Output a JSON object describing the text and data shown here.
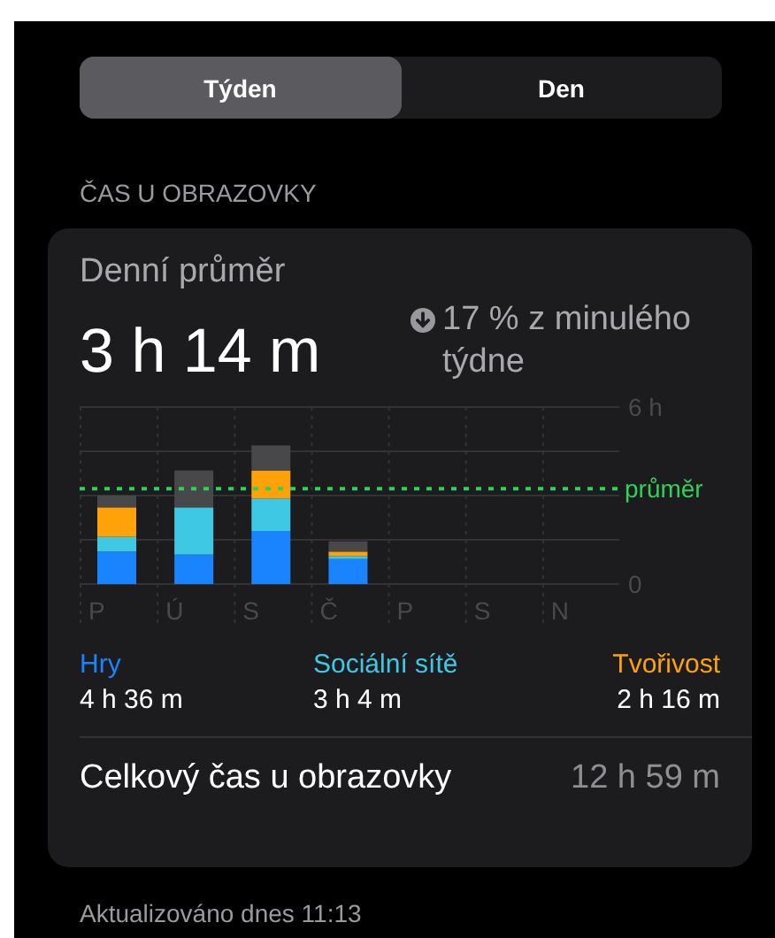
{
  "tabs": [
    {
      "label": "Týden",
      "selected": true
    },
    {
      "label": "Den",
      "selected": false
    }
  ],
  "section_title": "ČAS U OBRAZOVKY",
  "card": {
    "title": "Denní průměr",
    "average": "3 h 14 m",
    "change": "17 % z minulého týdne",
    "chart_data": {
      "type": "bar",
      "stacked": true,
      "categories": [
        "P",
        "Ú",
        "S",
        "Č",
        "P",
        "S",
        "N"
      ],
      "series": [
        {
          "name": "Hry",
          "color": "#1a84ff",
          "values": [
            1.1,
            1.0,
            1.8,
            0.85,
            null,
            null,
            null
          ]
        },
        {
          "name": "Sociální sítě",
          "color": "#3fc8e4",
          "values": [
            0.5,
            1.6,
            1.1,
            0.1,
            null,
            null,
            null
          ]
        },
        {
          "name": "Tvořivost",
          "color": "#ffa20a",
          "values": [
            1.0,
            0,
            0.95,
            0.15,
            null,
            null,
            null
          ]
        },
        {
          "color": "#48484a",
          "values": [
            0.4,
            1.25,
            0.85,
            0.35,
            null,
            null,
            null
          ]
        }
      ],
      "ylim": [
        0,
        6
      ],
      "yticks": [
        {
          "value": 0,
          "label": "0"
        },
        {
          "value": 6,
          "label": "6 h"
        }
      ],
      "ref_lines": [
        {
          "axis": "y",
          "value": 3.23,
          "label": "průměr",
          "color": "#30d158"
        }
      ]
    },
    "category_times": [
      "4 h 36 m",
      "3 h 4 m",
      "2 h 16 m"
    ],
    "total": {
      "label": "Celkový čas u obrazovky",
      "value": "12 h 59 m"
    }
  },
  "footer": "Aktualizováno dnes 11:13"
}
